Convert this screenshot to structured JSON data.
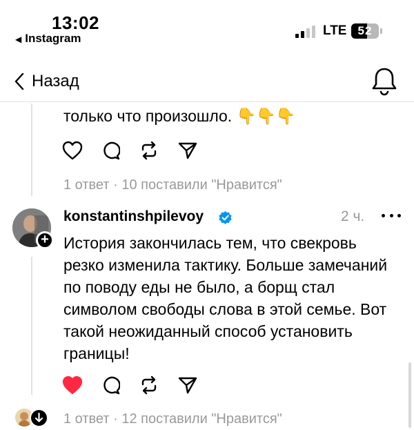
{
  "status_bar": {
    "time": "13:02",
    "back_app": "Instagram",
    "network": "LTE",
    "battery": "52"
  },
  "nav": {
    "back_label": "Назад"
  },
  "previous_post": {
    "text_tail": "только что произошло. 👇👇👇",
    "meta": "1 ответ · 10 поставили \"Нравится\""
  },
  "reply": {
    "username": "konstantinshpilevoy",
    "time_ago": "2 ч.",
    "text_lines": [
      "История закончилась тем, что свекровь",
      "резко изменила тактику. Больше замечаний",
      "по поводу еды не было, а борщ стал",
      "символом свободы слова в этой семье. Вот",
      "такой неожиданный способ установить",
      "границы!"
    ],
    "liked": true,
    "like_color": "#ff2742",
    "meta": "1 ответ · 12 поставили \"Нравится\""
  },
  "icons": {
    "back": "chevron-left-icon",
    "notifications": "bell-icon",
    "like": "heart-icon",
    "comment": "comment-bubble-icon",
    "repost": "repost-icon",
    "share": "send-icon",
    "verified": "verified-badge-icon",
    "more": "more-dots-icon"
  },
  "colors": {
    "verified_blue": "#0095f6",
    "secondary_text": "#999999"
  }
}
